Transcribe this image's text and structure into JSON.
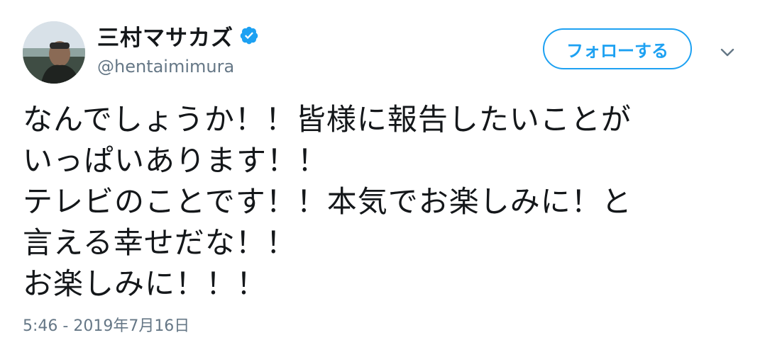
{
  "author": {
    "display_name": "三村マサカズ",
    "handle": "@hentaimimura",
    "verified": true
  },
  "actions": {
    "follow_label": "フォローする"
  },
  "tweet": {
    "lines": [
      "なんでしょうか！！皆様に報告したいことが",
      "いっぱいあります！！",
      "テレビのことです！！本気でお楽しみに！と",
      "言える幸せだな！！",
      "お楽しみに！！！"
    ],
    "timestamp": "5:46 - 2019年7月16日"
  },
  "colors": {
    "accent": "#1da1f2",
    "text": "#14171a",
    "secondary": "#657786"
  },
  "icons": {
    "verified": "verified-badge-icon",
    "menu": "chevron-down-icon"
  }
}
